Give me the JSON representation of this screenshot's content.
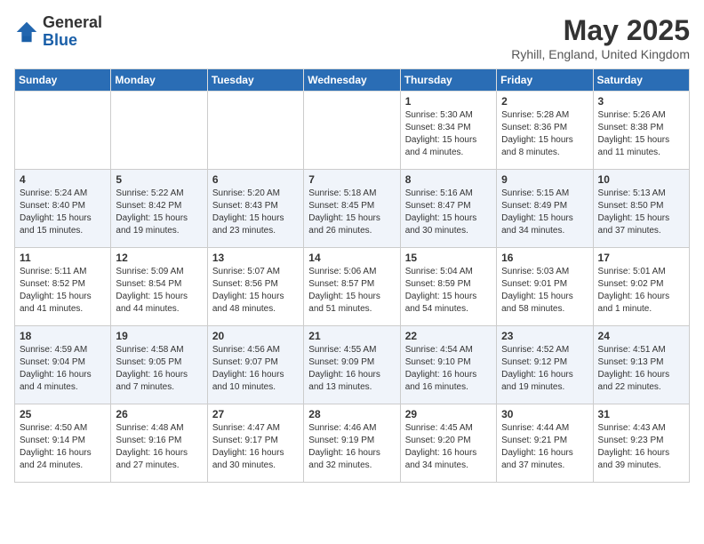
{
  "header": {
    "logo_general": "General",
    "logo_blue": "Blue",
    "month_title": "May 2025",
    "location": "Ryhill, England, United Kingdom"
  },
  "days_of_week": [
    "Sunday",
    "Monday",
    "Tuesday",
    "Wednesday",
    "Thursday",
    "Friday",
    "Saturday"
  ],
  "weeks": [
    [
      {
        "day": "",
        "info": ""
      },
      {
        "day": "",
        "info": ""
      },
      {
        "day": "",
        "info": ""
      },
      {
        "day": "",
        "info": ""
      },
      {
        "day": "1",
        "info": "Sunrise: 5:30 AM\nSunset: 8:34 PM\nDaylight: 15 hours\nand 4 minutes."
      },
      {
        "day": "2",
        "info": "Sunrise: 5:28 AM\nSunset: 8:36 PM\nDaylight: 15 hours\nand 8 minutes."
      },
      {
        "day": "3",
        "info": "Sunrise: 5:26 AM\nSunset: 8:38 PM\nDaylight: 15 hours\nand 11 minutes."
      }
    ],
    [
      {
        "day": "4",
        "info": "Sunrise: 5:24 AM\nSunset: 8:40 PM\nDaylight: 15 hours\nand 15 minutes."
      },
      {
        "day": "5",
        "info": "Sunrise: 5:22 AM\nSunset: 8:42 PM\nDaylight: 15 hours\nand 19 minutes."
      },
      {
        "day": "6",
        "info": "Sunrise: 5:20 AM\nSunset: 8:43 PM\nDaylight: 15 hours\nand 23 minutes."
      },
      {
        "day": "7",
        "info": "Sunrise: 5:18 AM\nSunset: 8:45 PM\nDaylight: 15 hours\nand 26 minutes."
      },
      {
        "day": "8",
        "info": "Sunrise: 5:16 AM\nSunset: 8:47 PM\nDaylight: 15 hours\nand 30 minutes."
      },
      {
        "day": "9",
        "info": "Sunrise: 5:15 AM\nSunset: 8:49 PM\nDaylight: 15 hours\nand 34 minutes."
      },
      {
        "day": "10",
        "info": "Sunrise: 5:13 AM\nSunset: 8:50 PM\nDaylight: 15 hours\nand 37 minutes."
      }
    ],
    [
      {
        "day": "11",
        "info": "Sunrise: 5:11 AM\nSunset: 8:52 PM\nDaylight: 15 hours\nand 41 minutes."
      },
      {
        "day": "12",
        "info": "Sunrise: 5:09 AM\nSunset: 8:54 PM\nDaylight: 15 hours\nand 44 minutes."
      },
      {
        "day": "13",
        "info": "Sunrise: 5:07 AM\nSunset: 8:56 PM\nDaylight: 15 hours\nand 48 minutes."
      },
      {
        "day": "14",
        "info": "Sunrise: 5:06 AM\nSunset: 8:57 PM\nDaylight: 15 hours\nand 51 minutes."
      },
      {
        "day": "15",
        "info": "Sunrise: 5:04 AM\nSunset: 8:59 PM\nDaylight: 15 hours\nand 54 minutes."
      },
      {
        "day": "16",
        "info": "Sunrise: 5:03 AM\nSunset: 9:01 PM\nDaylight: 15 hours\nand 58 minutes."
      },
      {
        "day": "17",
        "info": "Sunrise: 5:01 AM\nSunset: 9:02 PM\nDaylight: 16 hours\nand 1 minute."
      }
    ],
    [
      {
        "day": "18",
        "info": "Sunrise: 4:59 AM\nSunset: 9:04 PM\nDaylight: 16 hours\nand 4 minutes."
      },
      {
        "day": "19",
        "info": "Sunrise: 4:58 AM\nSunset: 9:05 PM\nDaylight: 16 hours\nand 7 minutes."
      },
      {
        "day": "20",
        "info": "Sunrise: 4:56 AM\nSunset: 9:07 PM\nDaylight: 16 hours\nand 10 minutes."
      },
      {
        "day": "21",
        "info": "Sunrise: 4:55 AM\nSunset: 9:09 PM\nDaylight: 16 hours\nand 13 minutes."
      },
      {
        "day": "22",
        "info": "Sunrise: 4:54 AM\nSunset: 9:10 PM\nDaylight: 16 hours\nand 16 minutes."
      },
      {
        "day": "23",
        "info": "Sunrise: 4:52 AM\nSunset: 9:12 PM\nDaylight: 16 hours\nand 19 minutes."
      },
      {
        "day": "24",
        "info": "Sunrise: 4:51 AM\nSunset: 9:13 PM\nDaylight: 16 hours\nand 22 minutes."
      }
    ],
    [
      {
        "day": "25",
        "info": "Sunrise: 4:50 AM\nSunset: 9:14 PM\nDaylight: 16 hours\nand 24 minutes."
      },
      {
        "day": "26",
        "info": "Sunrise: 4:48 AM\nSunset: 9:16 PM\nDaylight: 16 hours\nand 27 minutes."
      },
      {
        "day": "27",
        "info": "Sunrise: 4:47 AM\nSunset: 9:17 PM\nDaylight: 16 hours\nand 30 minutes."
      },
      {
        "day": "28",
        "info": "Sunrise: 4:46 AM\nSunset: 9:19 PM\nDaylight: 16 hours\nand 32 minutes."
      },
      {
        "day": "29",
        "info": "Sunrise: 4:45 AM\nSunset: 9:20 PM\nDaylight: 16 hours\nand 34 minutes."
      },
      {
        "day": "30",
        "info": "Sunrise: 4:44 AM\nSunset: 9:21 PM\nDaylight: 16 hours\nand 37 minutes."
      },
      {
        "day": "31",
        "info": "Sunrise: 4:43 AM\nSunset: 9:23 PM\nDaylight: 16 hours\nand 39 minutes."
      }
    ]
  ]
}
